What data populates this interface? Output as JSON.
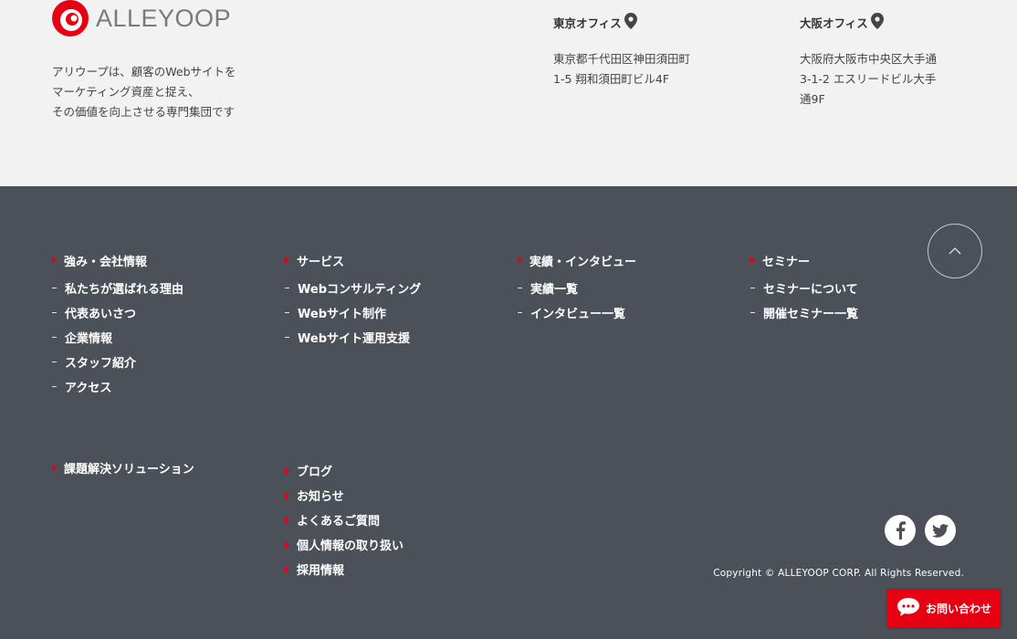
{
  "brand": {
    "name": "ALLEYOOP",
    "accent": "#e60012"
  },
  "tagline": [
    "アリウープは、顧客のWebサイトを",
    "マーケティング資産と捉え、",
    "その価値を向上させる専門集団です"
  ],
  "offices": {
    "tokyo": {
      "title": "東京オフィス",
      "address": [
        "東京都千代田区神田須田町",
        "1-5 翔和須田町ビル4F"
      ]
    },
    "osaka": {
      "title": "大阪オフィス",
      "address": [
        "大阪府大阪市中央区大手通",
        "3-1-2 エスリードビル大手",
        "通9F"
      ]
    }
  },
  "nav": {
    "col1": {
      "head": "強み・会社情報",
      "items": [
        "私たちが選ばれる理由",
        "代表あいさつ",
        "企業情報",
        "スタッフ紹介",
        "アクセス"
      ]
    },
    "col2": {
      "head": "サービス",
      "items": [
        "Webコンサルティング",
        "Webサイト制作",
        "Webサイト運用支援"
      ]
    },
    "col3": {
      "head": "実績・インタビュー",
      "items": [
        "実績一覧",
        "インタビュー一覧"
      ]
    },
    "col4": {
      "head": "セミナー",
      "items": [
        "セミナーについて",
        "開催セミナー一覧"
      ]
    },
    "col5": {
      "head": "課題解決ソリューション"
    },
    "col6": {
      "links": [
        "ブログ",
        "お知らせ",
        "よくあるご質問",
        "個人情報の取り扱い",
        "採用情報"
      ]
    }
  },
  "social": {
    "facebook_icon": "facebook-icon",
    "twitter_icon": "twitter-icon"
  },
  "copyright": "Copyright © ALLEYOOP CORP. All Rights Reserved.",
  "contact": {
    "label": "お問い合わせ"
  }
}
